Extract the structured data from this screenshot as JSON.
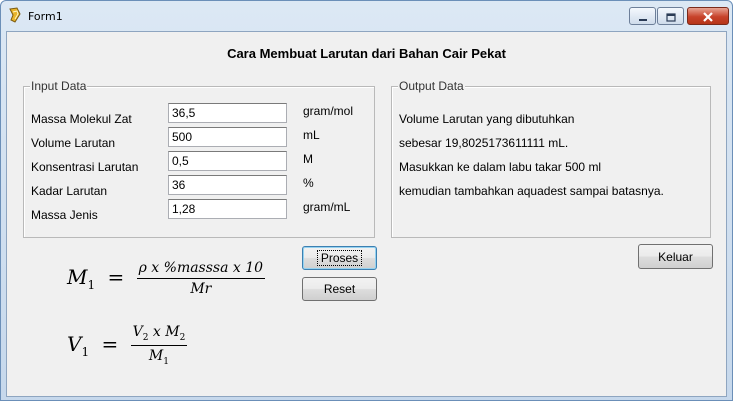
{
  "window": {
    "title": "Form1"
  },
  "heading": "Cara Membuat Larutan dari Bahan Cair Pekat",
  "input_group": {
    "legend": "Input Data",
    "fields": [
      {
        "label": "Massa Molekul Zat",
        "value": "36,5",
        "unit": "gram/mol"
      },
      {
        "label": "Volume Larutan",
        "value": "500",
        "unit": "mL"
      },
      {
        "label": "Konsentrasi Larutan",
        "value": "0,5",
        "unit": "M"
      },
      {
        "label": "Kadar Larutan",
        "value": "36",
        "unit": "%"
      },
      {
        "label": "Massa Jenis",
        "value": "1,28",
        "unit": "gram/mL"
      }
    ]
  },
  "output_group": {
    "legend": "Output Data",
    "lines": [
      "Volume Larutan yang dibutuhkan",
      "sebesar 19,8025173611111 mL.",
      "Masukkan ke dalam labu takar 500 ml",
      "kemudian tambahkan aquadest sampai batasnya."
    ]
  },
  "buttons": {
    "proses": "Proses",
    "reset": "Reset",
    "keluar": "Keluar"
  },
  "formula1": {
    "lhs": "M",
    "lhs_sub": "1",
    "eq": "=",
    "numerator": "ρ x %masssa x 10",
    "denominator": "Mr"
  },
  "formula2": {
    "lhs": "V",
    "lhs_sub": "1",
    "eq": "=",
    "num_a": "V",
    "num_a_sub": "2",
    "num_mid": " x ",
    "num_b": "M",
    "num_b_sub": "2",
    "den": "M",
    "den_sub": "1"
  },
  "colors": {
    "close_button": "#c7422a",
    "window_frame": "#c6d8ec",
    "client_bg": "#f0f0f0"
  },
  "icons": {
    "app": "delphi-icon",
    "minimize": "minimize-icon",
    "maximize": "maximize-icon",
    "close": "close-icon"
  }
}
